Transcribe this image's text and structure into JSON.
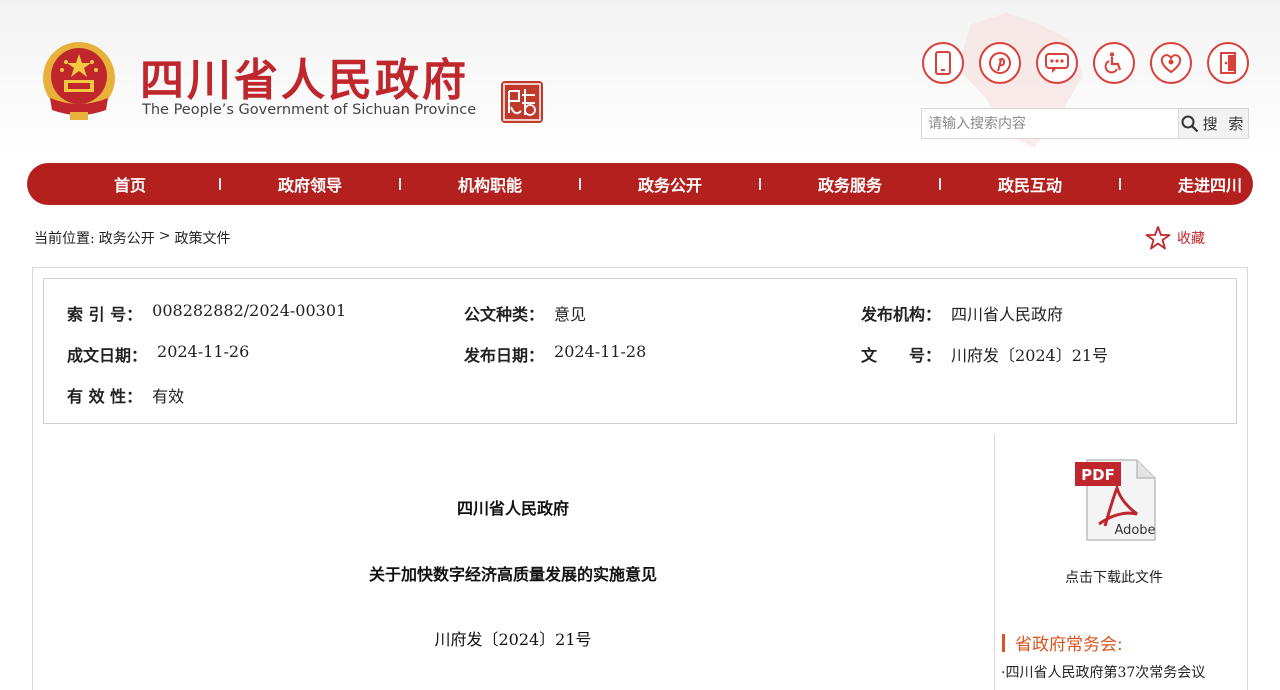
{
  "header": {
    "title": "四川省人民政府",
    "subtitle": "The People’s Government of Sichuan Province",
    "tool_icons": [
      "mobile-icon",
      "pinterest-icon",
      "message-icon",
      "wheelchair-icon",
      "elder-care-icon",
      "exit-icon"
    ],
    "search": {
      "placeholder": "请输入搜索内容",
      "button_label": "搜 索"
    },
    "colors": {
      "brand_red": "#c0272d",
      "nav_red": "#b4201e"
    }
  },
  "nav": {
    "items": [
      "首页",
      "政府领导",
      "机构职能",
      "政务公开",
      "政务服务",
      "政民互动",
      "走进四川"
    ]
  },
  "breadcrumb": {
    "prefix": "当前位置:",
    "path": [
      "政务公开",
      "政策文件"
    ],
    "separator": ">"
  },
  "favorite": {
    "label": "收藏"
  },
  "meta": {
    "index_label": "索 引 号：",
    "index_value": "008282882/2024-00301",
    "category_label": "公文种类：",
    "category_value": "意见",
    "issuer_label": "发布机构：",
    "issuer_value": "四川省人民政府",
    "created_label": "成文日期：",
    "created_value": "2024-11-26",
    "published_label": "发布日期：",
    "published_value": "2024-11-28",
    "docno_label": "文　　号：",
    "docno_value": "川府发〔2024〕21号",
    "validity_label": "有 效 性：",
    "validity_value": "有效"
  },
  "document": {
    "issuer": "四川省人民政府",
    "title": "关于加快数字经济高质量发展的实施意见",
    "number": "川府发〔2024〕21号"
  },
  "sidebar": {
    "download_label": "点击下载此文件",
    "section_title": "省政府常务会:",
    "items": [
      "·四川省人民政府第37次常务会议"
    ]
  }
}
